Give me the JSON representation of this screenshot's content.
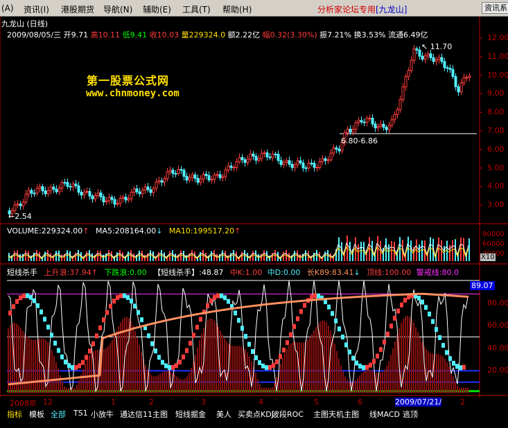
{
  "menu": {
    "items": [
      "(A)",
      "资讯(I)",
      "港股期货",
      "导航(N)",
      "辅助(E)",
      "工具(T)",
      "帮助(H)"
    ],
    "brand": "分析家论坛专用",
    "brand_tag": "[九龙山]",
    "right_button": "资讯系"
  },
  "stock": {
    "name": "九龙山",
    "period": "(日线)",
    "date": "2009/08/05/三",
    "open_label": "开",
    "open": "9.71",
    "high_label": "高",
    "high": "10.11",
    "low_label": "低",
    "low": "9.41",
    "close_label": "收",
    "close": "10.03",
    "volume_label": "量",
    "volume": "229324.0",
    "amount_label": "额",
    "amount": "2.22亿",
    "change_label": "幅",
    "change": "0.32(3.30%)",
    "swing_label": "振",
    "swing": "7.21%",
    "turnover_label": "换",
    "turnover": "3.53%",
    "float_label": "流通",
    "float": "6.49亿"
  },
  "watermark": {
    "line1": "第一股票公式网",
    "line2": "www.chnmoney.com"
  },
  "price_panel": {
    "axis_labels": [
      "12.00",
      "11.00",
      "10.00",
      "9.00",
      "8.00",
      "7.00",
      "6.00",
      "5.00",
      "4.00",
      "3.00"
    ],
    "high_marker": "11.70",
    "low_marker": "2.54",
    "level_label": "6.80-6.86"
  },
  "volume_panel": {
    "volume_text": "VOLUME:229324.00",
    "ma5_text": "MA5:208164.00",
    "ma10_text": "MA10:199517.20",
    "axis_labels": [
      "90000",
      "60000",
      "30000"
    ],
    "unit": "X10"
  },
  "indicator_panel": {
    "name": "短线杀手",
    "up": "上升浪:37.94",
    "down": "下跌浪:0.00",
    "main": "【短线杀手】:48.87",
    "mid_k": "中K:1.00",
    "mid_d": "中D:0.00",
    "long_k": "长K89:83.41",
    "top_line": "顶线:100.00",
    "warn_line": "警戒线:80.0",
    "axis_labels": [
      "80.00",
      "60.00",
      "40.00",
      "20.00"
    ],
    "current_value": "89.07"
  },
  "time_axis": {
    "labels": [
      "2008年",
      "12",
      "1",
      "2",
      "3",
      "4",
      "5",
      "6",
      "2009/07/21/"
    ],
    "end_label": "2"
  },
  "bottom_tabs": [
    "指标",
    "模板",
    "全部",
    "TS1",
    "小放牛",
    "通达信11主图",
    "短线掘金",
    "美人",
    "买卖点KDJ",
    "波段ROC",
    "主图天机主图",
    "线MACD",
    "逃顶"
  ],
  "colors": {
    "up": "#ff3c3c",
    "down": "#4ff0ff",
    "axis": "#c00000",
    "yellow": "#ffe000",
    "orange": "#ff9060",
    "magenta": "#ff30ff"
  }
}
